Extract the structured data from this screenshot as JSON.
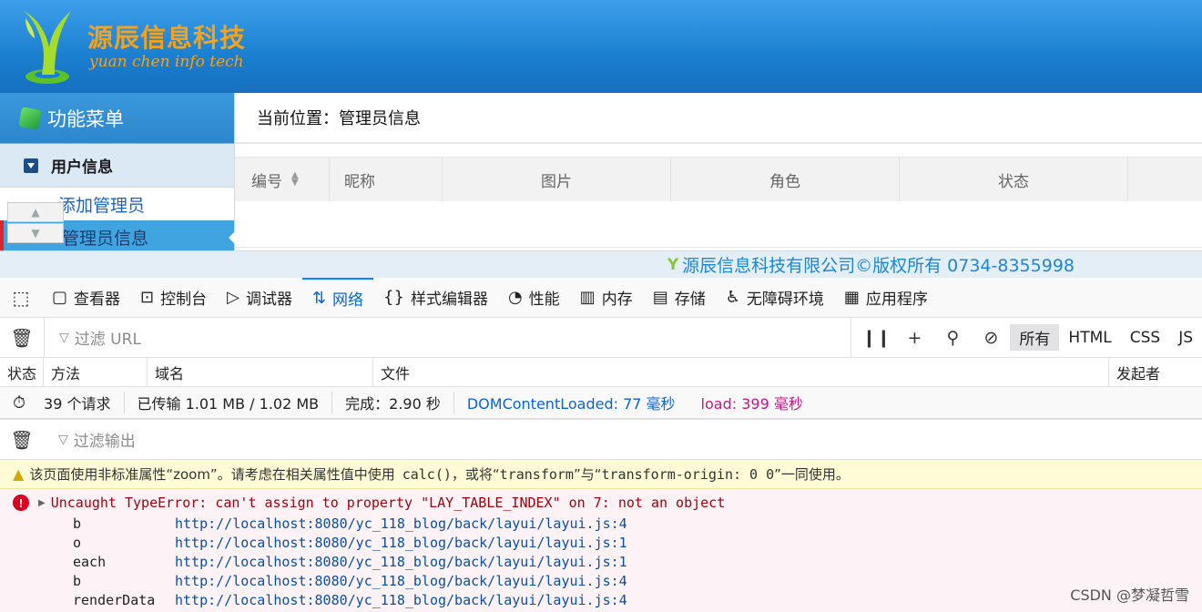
{
  "banner": {
    "logo_cn": "源辰信息科技",
    "logo_en": "yuan chen info tech"
  },
  "sidebar": {
    "menu_title": "功能菜单",
    "group_label": "用户信息",
    "items": [
      {
        "label": "添加管理员",
        "active": false
      },
      {
        "label": "管理员信息",
        "active": true
      }
    ]
  },
  "main": {
    "breadcrumb": "当前位置：管理员信息",
    "columns": [
      "编号",
      "昵称",
      "图片",
      "角色",
      "状态"
    ]
  },
  "footer": {
    "copyright": "源辰信息科技有限公司©版权所有 0734-8355998"
  },
  "devtools": {
    "tabs": [
      {
        "label": "查看器",
        "icon": "inspector-icon"
      },
      {
        "label": "控制台",
        "icon": "console-icon"
      },
      {
        "label": "调试器",
        "icon": "debugger-icon"
      },
      {
        "label": "网络",
        "icon": "network-icon",
        "active": true
      },
      {
        "label": "样式编辑器",
        "icon": "style-editor-icon"
      },
      {
        "label": "性能",
        "icon": "performance-icon"
      },
      {
        "label": "内存",
        "icon": "memory-icon"
      },
      {
        "label": "存储",
        "icon": "storage-icon"
      },
      {
        "label": "无障碍环境",
        "icon": "accessibility-icon"
      },
      {
        "label": "应用程序",
        "icon": "application-icon"
      }
    ],
    "network": {
      "filter_placeholder": "过滤 URL",
      "types": [
        "所有",
        "HTML",
        "CSS",
        "JS"
      ],
      "active_type": "所有",
      "columns": [
        "状态",
        "方法",
        "域名",
        "文件",
        "发起者"
      ],
      "summary": {
        "requests": "39 个请求",
        "transferred": "已传输 1.01 MB / 1.02 MB",
        "finish": "完成：2.90 秒",
        "dom_loaded": "DOMContentLoaded: 77 毫秒",
        "load": "load: 399 毫秒"
      }
    },
    "console": {
      "filter_placeholder": "过滤输出",
      "warning": {
        "pre": "该页面使用非标准属性“zoom”。请考虑在相关属性值中使用",
        "code1": "calc()",
        "mid": "，或将“",
        "code2": "transform",
        "mid2": "”与“",
        "code3": "transform-origin: 0 0",
        "post": "”一同使用。"
      },
      "error": {
        "message": "Uncaught TypeError: can't assign to property \"LAY_TABLE_INDEX\" on 7: not an object",
        "stack": [
          {
            "fn": "b",
            "loc": "http://localhost:8080/yc_118_blog/back/layui/layui.js:4"
          },
          {
            "fn": "o",
            "loc": "http://localhost:8080/yc_118_blog/back/layui/layui.js:1"
          },
          {
            "fn": "each",
            "loc": "http://localhost:8080/yc_118_blog/back/layui/layui.js:1"
          },
          {
            "fn": "b",
            "loc": "http://localhost:8080/yc_118_blog/back/layui/layui.js:4"
          },
          {
            "fn": "renderData",
            "loc": "http://localhost:8080/yc_118_blog/back/layui/layui.js:4"
          }
        ]
      }
    }
  },
  "watermark": "CSDN @梦凝哲雪",
  "colors": {
    "accent": "#0a84ff",
    "banner": "#1b7fd0",
    "error": "#a4000f",
    "warning_bg": "#fffbd6"
  }
}
